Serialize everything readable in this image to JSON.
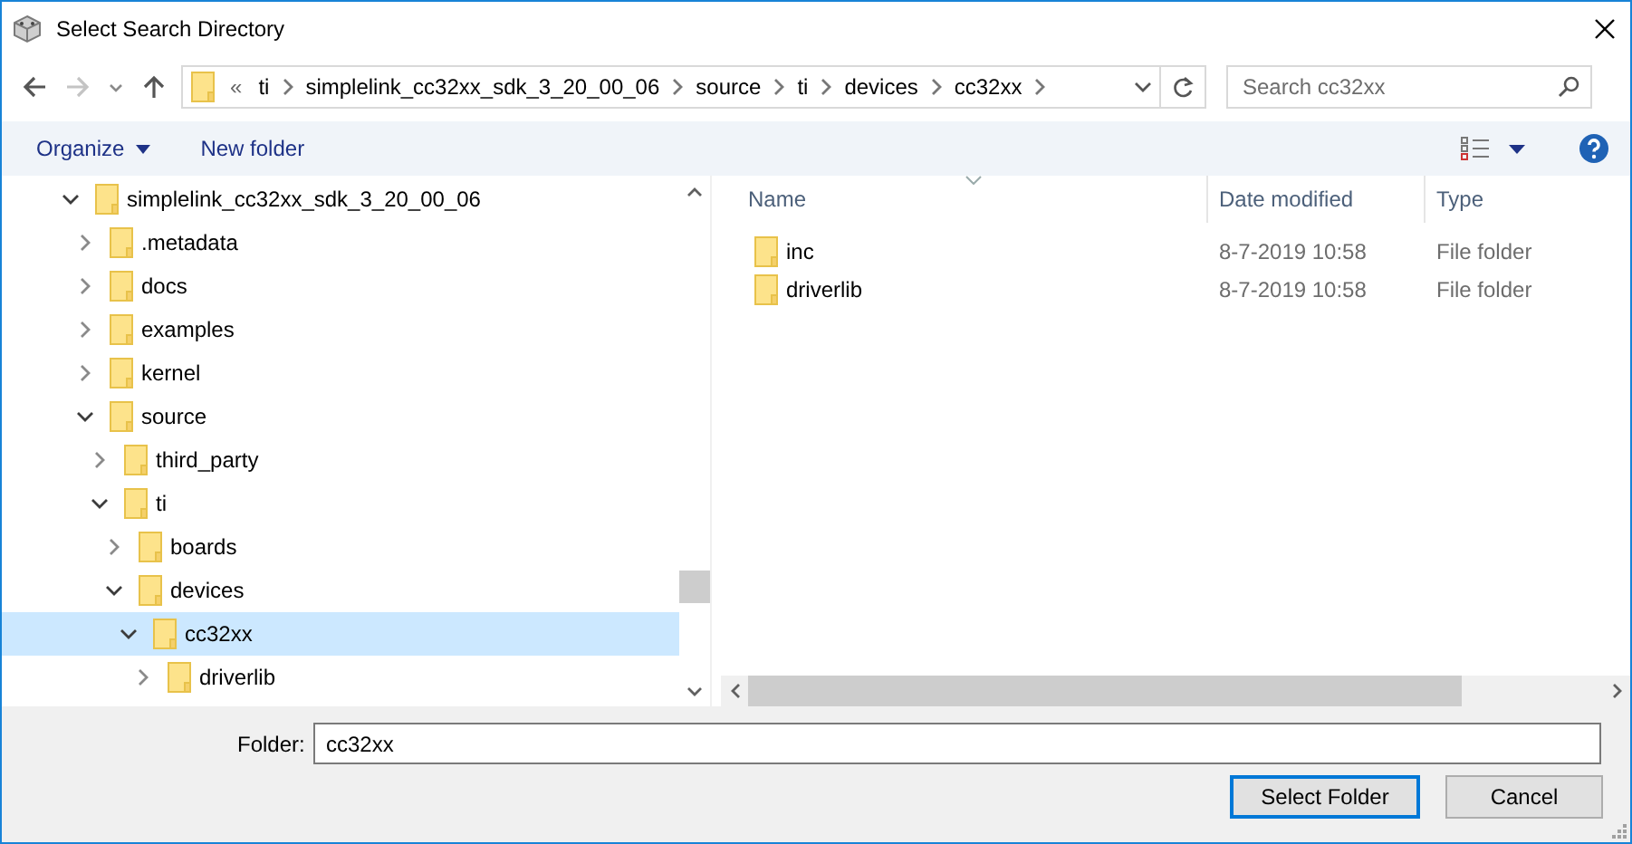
{
  "window": {
    "title": "Select Search Directory"
  },
  "address_bar": {
    "overflow": "«",
    "segments": [
      "ti",
      "simplelink_cc32xx_sdk_3_20_00_06",
      "source",
      "ti",
      "devices",
      "cc32xx"
    ]
  },
  "search": {
    "placeholder": "Search cc32xx"
  },
  "toolbar": {
    "buttons": [
      {
        "label": "Organize",
        "kind": "menu"
      },
      {
        "label": "New folder",
        "kind": "plain"
      }
    ]
  },
  "tree": [
    {
      "label": "simplelink_cc32xx_sdk_3_20_00_06",
      "expanded": true,
      "selected": false,
      "children": [
        {
          "label": ".metadata",
          "expanded": false,
          "selected": false
        },
        {
          "label": "docs",
          "expanded": false,
          "selected": false
        },
        {
          "label": "examples",
          "expanded": false,
          "selected": false
        },
        {
          "label": "kernel",
          "expanded": false,
          "selected": false
        },
        {
          "label": "source",
          "expanded": true,
          "selected": false,
          "children": [
            {
              "label": "third_party",
              "expanded": false,
              "selected": false
            },
            {
              "label": "ti",
              "expanded": true,
              "selected": false,
              "children": [
                {
                  "label": "boards",
                  "expanded": false,
                  "selected": false
                },
                {
                  "label": "devices",
                  "expanded": true,
                  "selected": false,
                  "children": [
                    {
                      "label": "cc32xx",
                      "expanded": true,
                      "selected": true,
                      "children": [
                        {
                          "label": "driverlib",
                          "expanded": false,
                          "selected": false
                        }
                      ]
                    }
                  ]
                }
              ]
            }
          ]
        }
      ]
    }
  ],
  "columns": [
    {
      "label": "Name",
      "sorted": true
    },
    {
      "label": "Date modified",
      "sorted": false
    },
    {
      "label": "Type",
      "sorted": false
    }
  ],
  "files": [
    {
      "name": "inc",
      "date": "8-7-2019 10:58",
      "type": "File folder"
    },
    {
      "name": "driverlib",
      "date": "8-7-2019 10:58",
      "type": "File folder"
    }
  ],
  "folder_field": {
    "label": "Folder:",
    "value": "cc32xx"
  },
  "buttons": [
    {
      "label": "Select Folder",
      "default": true
    },
    {
      "label": "Cancel",
      "default": false
    }
  ]
}
